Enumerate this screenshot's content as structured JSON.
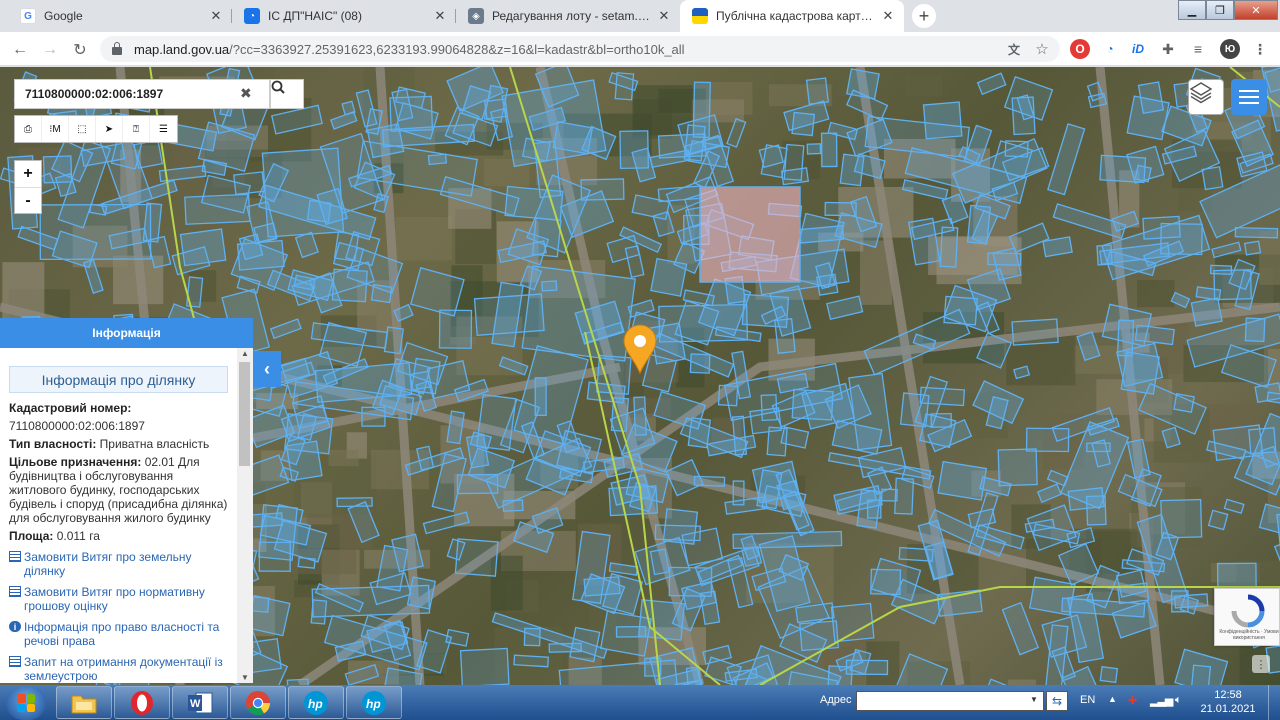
{
  "browser": {
    "tabs": [
      {
        "title": "Google",
        "icon": "google-icon",
        "icon_letter": "G",
        "icon_color": "#ffffff"
      },
      {
        "title": "ІС ДП\"НАІС\" (08)",
        "icon": "app-icon",
        "icon_letter": "◔",
        "icon_color": "#1a73e8"
      },
      {
        "title": "Редагування лоту - setam.net.ua",
        "icon": "shield-icon",
        "icon_letter": "◈",
        "icon_color": "#6b7b8c"
      },
      {
        "title": "Публічна кадастрова карта Укр",
        "icon": "ua-flag-icon",
        "icon_letter": "",
        "icon_color": "#ffd700"
      }
    ],
    "new_tab_label": "+",
    "url_host": "map.land.gov.ua",
    "url_rest": "/?cc=3363927.25391623,6233193.99064828&z=16&l=kadastr&bl=ortho10k_all",
    "profile_letter": "Ю"
  },
  "map": {
    "search_value": "7110800000:02:006:1897",
    "zoom_in": "+",
    "zoom_out": "-",
    "tools": [
      "print-icon",
      "measure-line-icon",
      "measure-area-icon",
      "pointer-icon",
      "identify-icon",
      "layers-settings-icon"
    ],
    "tool_glyphs": [
      "⎙",
      "⁝M",
      "⬚",
      "➤",
      "⍰",
      "☰"
    ],
    "recaptcha_text": "Конфіденційність · Умови використання",
    "accent": "#3b8ee6",
    "marker_color": "#f5a623",
    "parcel_color": "#5fb0f0",
    "boundary_color": "#b8d64a"
  },
  "info_panel": {
    "header": "Інформація",
    "title": "Інформація про ділянку",
    "cadastral_label": "Кадастровий номер:",
    "cadastral_value": "7110800000:02:006:1897",
    "ownership_label": "Тип власності:",
    "ownership_value": "Приватна власність",
    "purpose_label": "Цільове призначення:",
    "purpose_value": "02.01 Для будівництва і обслуговування житлового будинку, господарських будівель і споруд (присадибна ділянка) для обслуговування жилого будинку",
    "area_label": "Площа:",
    "area_value": "0.011 га",
    "links": [
      {
        "text": "Замовити Витяг про земельну ділянку",
        "icon": "document-icon"
      },
      {
        "text": "Замовити Витяг про нормативну грошову оцінку",
        "icon": "document-icon"
      },
      {
        "text": "Інформація про право власності та речові права",
        "icon": "info-icon"
      },
      {
        "text": "Запит на отримання документації із землеустрою",
        "icon": "document-icon"
      }
    ]
  },
  "taskbar": {
    "address_label": "Адрес",
    "language": "EN",
    "time": "12:58",
    "date": "21.01.2021"
  }
}
